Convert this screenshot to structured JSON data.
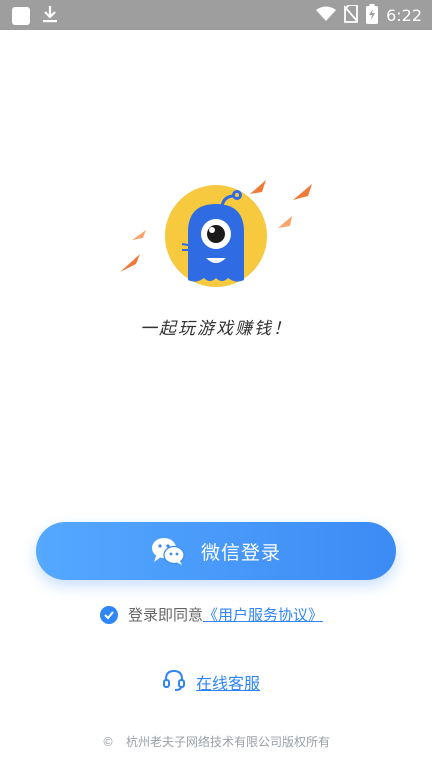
{
  "status_bar": {
    "time": "6:22",
    "icons": [
      "notification-square-icon",
      "download-icon",
      "wifi-icon",
      "no-sim-icon",
      "battery-charging-icon"
    ]
  },
  "branding": {
    "slogan": "一起玩游戏赚钱！",
    "logo_icon": "mascot-one-eyed-monster-icon",
    "colors": {
      "logo_circle": "#F6C93E",
      "mascot": "#2F6BE3",
      "sparks": "#F07A3A"
    }
  },
  "login": {
    "wechat_button_label": "微信登录",
    "button_icon": "wechat-icon",
    "button_color": "#3C8BF5"
  },
  "agreement": {
    "prefix": "登录即同意",
    "link": "《用户服务协议》",
    "checked": true
  },
  "support": {
    "label": "在线客服",
    "icon": "headset-icon"
  },
  "footer": {
    "copyright_symbol": "©",
    "company": "杭州老夫子网络技术有限公司版权所有"
  }
}
